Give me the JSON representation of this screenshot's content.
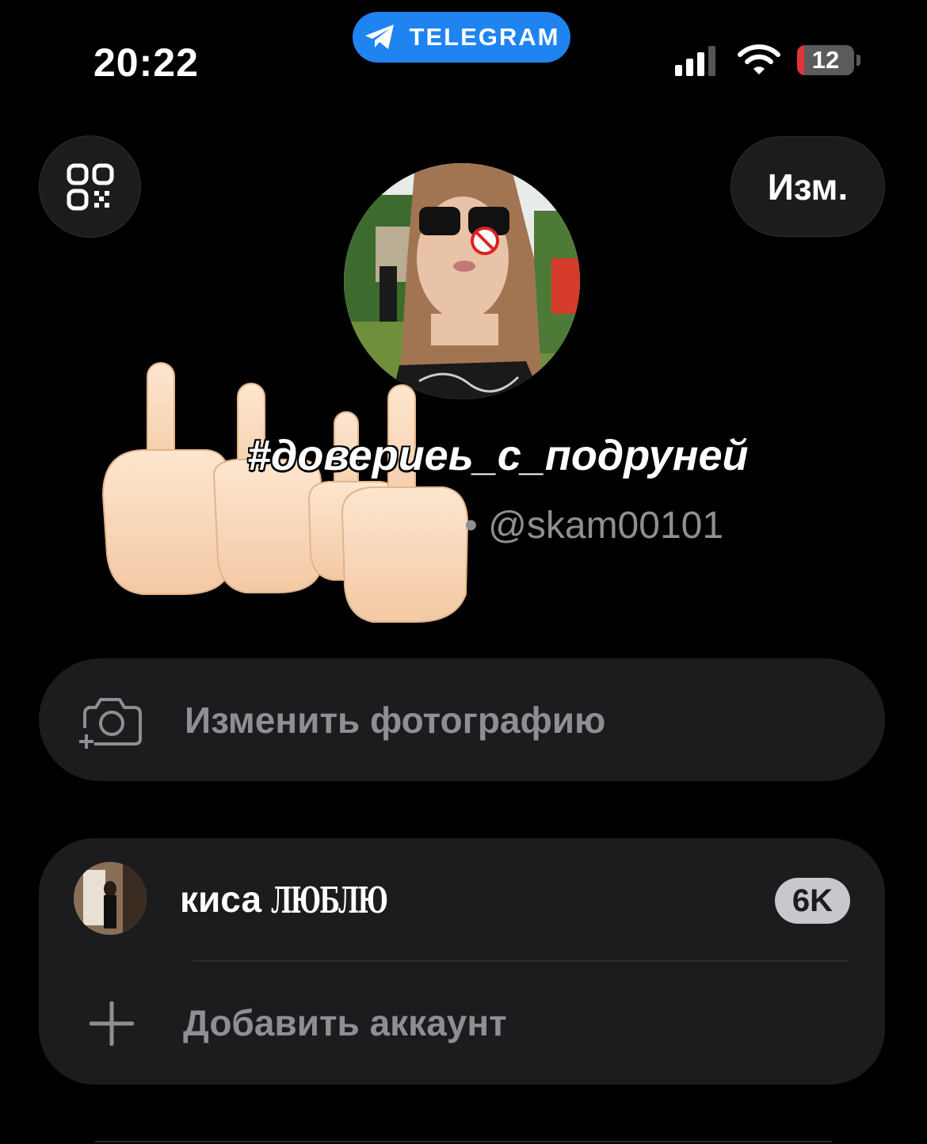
{
  "status_bar": {
    "time": "20:22",
    "app_pill": "TELEGRAM",
    "battery": "12",
    "battery_level_percent": 12,
    "signal_bars_active": 3,
    "signal_bars_total": 4
  },
  "header": {
    "qr_icon": "qr-code-icon",
    "edit_label": "Изм."
  },
  "profile": {
    "hashtag": "#довериеь_с_подруней",
    "username_suffix": "• @skam00101"
  },
  "actions": {
    "change_photo_label": "Изменить фотографию",
    "camera_icon": "add-camera-icon"
  },
  "accounts": {
    "items": [
      {
        "name": "киса",
        "decor": "ЛЮБЛЮ",
        "badge": "6K"
      }
    ],
    "add_label": "Добавить аккаунт"
  },
  "colors": {
    "accent": "#1f83f0",
    "card": "#1c1c1e",
    "muted_text": "#8e8e93",
    "battery_low": "#e3343c"
  }
}
